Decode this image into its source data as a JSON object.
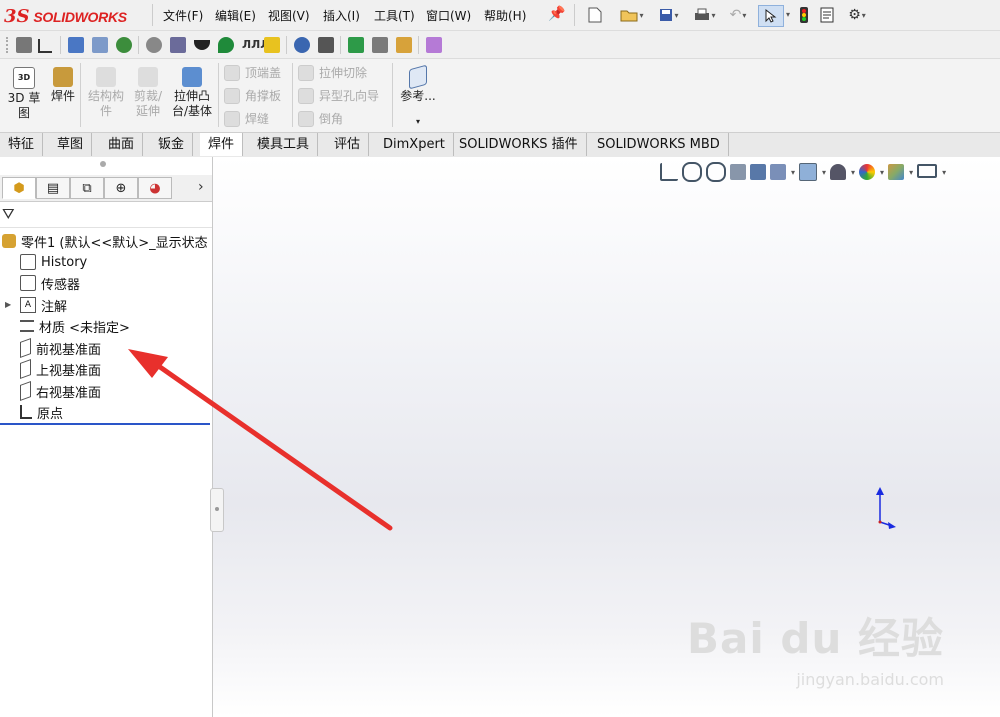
{
  "app": {
    "logo_ds": "3S",
    "logo_text": "SOLIDWORKS"
  },
  "menu": [
    "文件(F)",
    "编辑(E)",
    "视图(V)",
    "插入(I)",
    "工具(T)",
    "窗口(W)",
    "帮助(H)"
  ],
  "command_manager": {
    "sketch3d": "3D 草图",
    "weldments": "焊件",
    "structural": "结构构件",
    "trim_extend": "剪裁/延伸",
    "extrude_boss": "拉伸凸台/基体",
    "end_cap": "顶端盖",
    "gusset": "角撑板",
    "weld_bead": "焊缝",
    "extruded_cut": "拉伸切除",
    "hole_wizard": "异型孔向导",
    "chamfer": "倒角",
    "reference": "参考..."
  },
  "tabs": [
    "特征",
    "草图",
    "曲面",
    "钣金",
    "焊件",
    "模具工具",
    "评估",
    "DimXpert",
    "SOLIDWORKS 插件",
    "SOLIDWORKS MBD"
  ],
  "active_tab": "焊件",
  "tree": {
    "root": "零件1  (默认<<默认>_显示状态",
    "items": [
      "History",
      "传感器",
      "注解",
      "材质 <未指定>",
      "前视基准面",
      "上视基准面",
      "右视基准面",
      "原点"
    ]
  },
  "watermark": {
    "main": "Bai du 经验",
    "sub": "jingyan.baidu.com"
  },
  "colors": {
    "brand_red": "#d22020",
    "arrow_red": "#e8302c",
    "axis_blue": "#1a2be0"
  }
}
